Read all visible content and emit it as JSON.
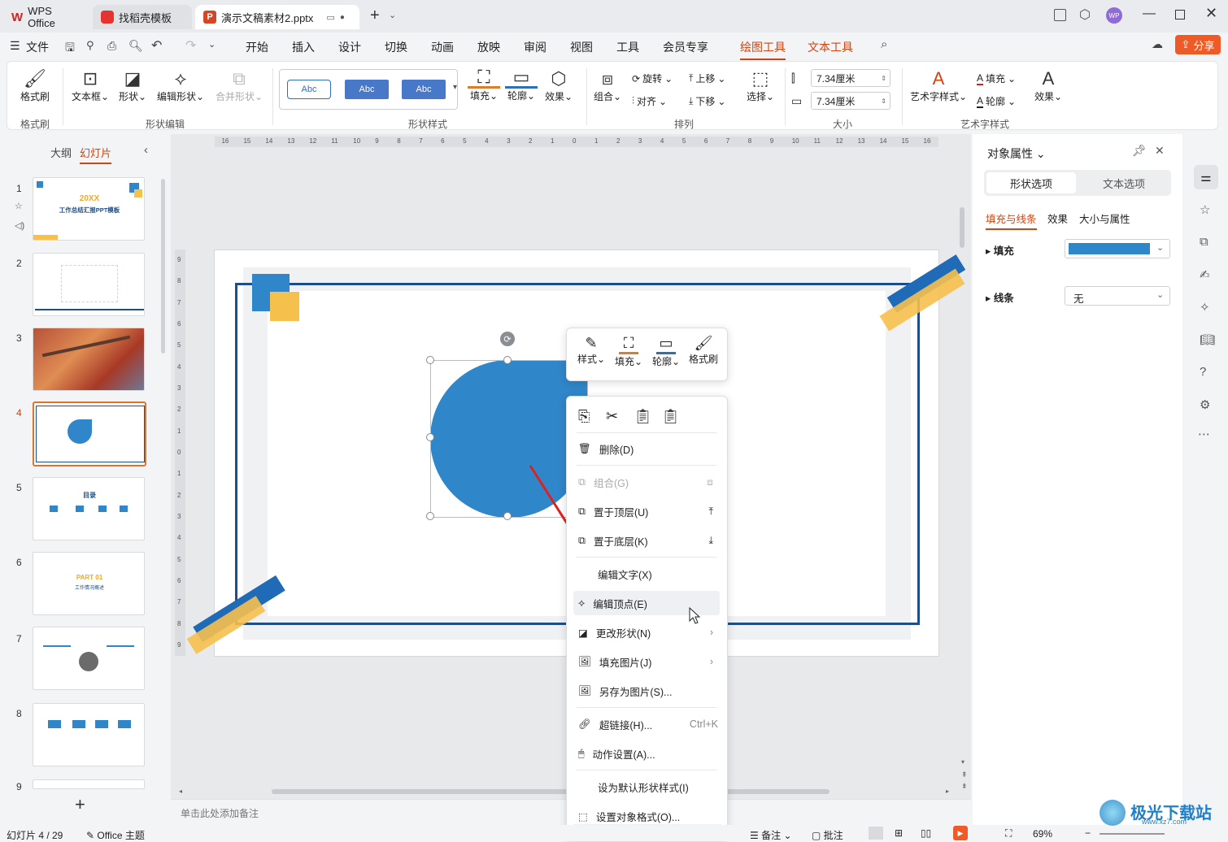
{
  "titlebar": {
    "wps_label": "WPS Office",
    "tab2": "找稻壳模板",
    "tab3": "演示文稿素材2.pptx",
    "avatar": "WP"
  },
  "menubar": {
    "file": "文件",
    "items": [
      "开始",
      "插入",
      "设计",
      "切换",
      "动画",
      "放映",
      "审阅",
      "视图",
      "工具",
      "会员专享",
      "绘图工具",
      "文本工具"
    ],
    "share": "分享"
  },
  "ribbon": {
    "format_brush": "格式刷",
    "format_group": "格式刷",
    "textbox": "文本框",
    "shape": "形状",
    "edit_shape": "编辑形状",
    "merge_shape": "合并形状",
    "shape_edit_group": "形状编辑",
    "style_samples": [
      "Abc",
      "Abc",
      "Abc"
    ],
    "fill": "填充",
    "outline": "轮廓",
    "effect": "效果",
    "shape_style_group": "形状样式",
    "combine": "组合",
    "rotate": "旋转",
    "align": "对齐",
    "move_up": "上移",
    "move_down": "下移",
    "select": "选择",
    "arrange_group": "排列",
    "width": "7.34厘米",
    "height": "7.34厘米",
    "size_group": "大小",
    "art_style": "艺术字样式",
    "text_fill": "填充",
    "text_outline": "轮廓",
    "text_effect": "效果",
    "art_group": "艺术字样式"
  },
  "leftpanel": {
    "outline_tab": "大纲",
    "slides_tab": "幻灯片",
    "slide_numbers": [
      "1",
      "2",
      "3",
      "4",
      "5",
      "6",
      "7",
      "8",
      "9"
    ],
    "thumb1_year": "20XX",
    "thumb1_title": "工作总结汇报PPT模板",
    "thumb5_title": "目录",
    "thumb6_part": "PART 01",
    "thumb6_sub": "工作情况概述",
    "add": "+"
  },
  "ruler": {
    "h": [
      "16",
      "15",
      "14",
      "13",
      "12",
      "11",
      "10",
      "9",
      "8",
      "7",
      "6",
      "5",
      "4",
      "3",
      "2",
      "1",
      "0",
      "1",
      "2",
      "3",
      "4",
      "5",
      "6",
      "7",
      "8",
      "9",
      "10",
      "11",
      "12",
      "13",
      "14",
      "15",
      "16"
    ],
    "v": [
      "9",
      "8",
      "7",
      "6",
      "5",
      "4",
      "3",
      "2",
      "1",
      "0",
      "1",
      "2",
      "3",
      "4",
      "5",
      "6",
      "7",
      "8",
      "9"
    ]
  },
  "notes_placeholder": "单击此处添加备注",
  "mini_toolbar": {
    "style": "样式",
    "fill": "填充",
    "outline": "轮廓",
    "brush": "格式刷"
  },
  "context_menu": {
    "delete": "删除(D)",
    "group": "组合(G)",
    "bring_front": "置于顶层(U)",
    "send_back": "置于底层(K)",
    "edit_text": "编辑文字(X)",
    "edit_points": "编辑顶点(E)",
    "change_shape": "更改形状(N)",
    "fill_picture": "填充图片(J)",
    "save_picture": "另存为图片(S)...",
    "hyperlink": "超链接(H)...",
    "hyperlink_shortcut": "Ctrl+K",
    "action": "动作设置(A)...",
    "default_style": "设为默认形状样式(I)",
    "format_object": "设置对象格式(O)..."
  },
  "rightpanel": {
    "title": "对象属性",
    "tab_shape": "形状选项",
    "tab_text": "文本选项",
    "sub_fill_line": "填充与线条",
    "sub_effect": "效果",
    "sub_size": "大小与属性",
    "fill_label": "填充",
    "fill_color": "#2f86c8",
    "line_label": "线条",
    "line_value": "无"
  },
  "statusbar": {
    "slide_info": "幻灯片 4 / 29",
    "theme": "Office 主题",
    "notes": "备注",
    "comment": "批注",
    "zoom": "69%"
  },
  "watermark": {
    "text": "极光下载站",
    "url": "www.xz7.com"
  },
  "colors": {
    "accent": "#d2440f",
    "shape_blue": "#2f86c8",
    "frame_navy": "#1d4e89",
    "gold": "#f6c04c"
  }
}
